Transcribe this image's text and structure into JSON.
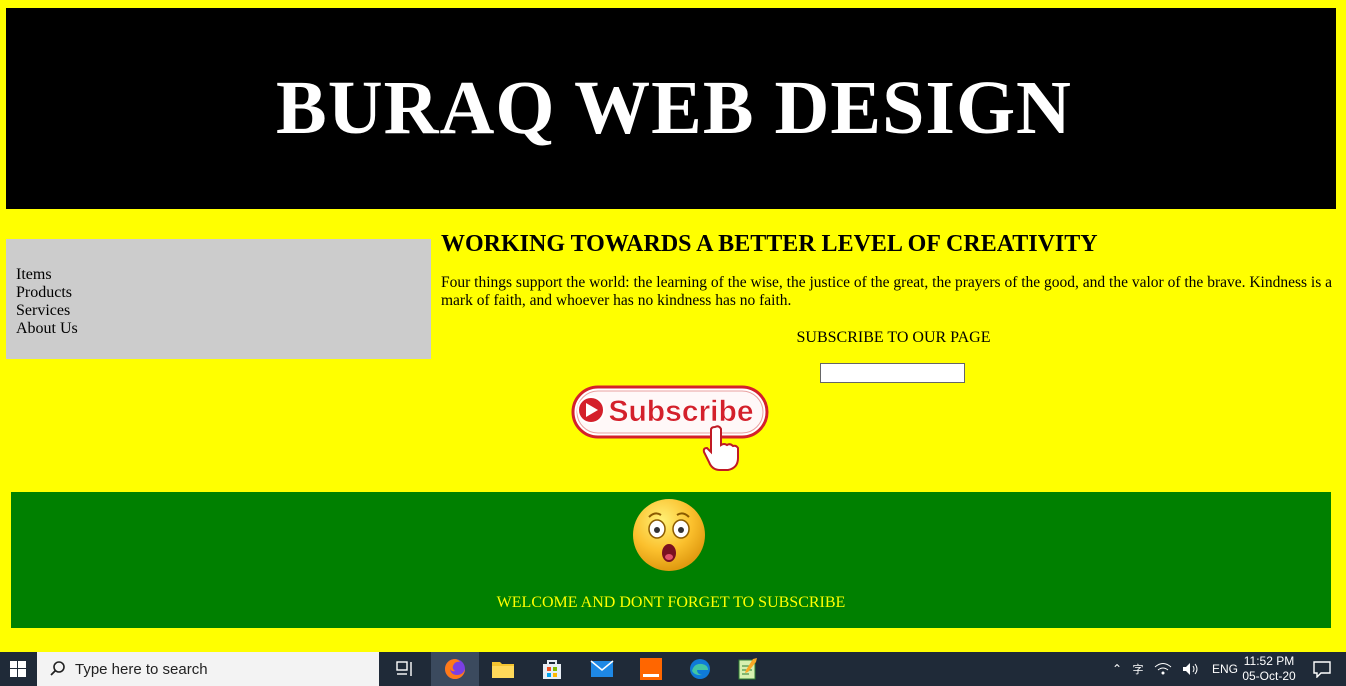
{
  "header": {
    "title": "BURAQ WEB DESIGN"
  },
  "sidebar": {
    "items": [
      {
        "label": "Items"
      },
      {
        "label": "Products"
      },
      {
        "label": "Services"
      },
      {
        "label": "About Us"
      }
    ]
  },
  "main": {
    "heading": "WORKING TOWARDS A BETTER LEVEL OF CREATIVITY",
    "paragraph": "Four things support the world: the learning of the wise, the justice of the great, the prayers of the good, and the valor of the brave. Kindness is a mark of faith, and whoever has no kindness has no faith.",
    "subscribe_title": "SUBSCRIBE TO OUR PAGE",
    "subscribe_input_value": "",
    "subscribe_button_label": "Subscribe"
  },
  "footer": {
    "emoji": "astonished-face",
    "text": "WELCOME AND DONT FORGET TO SUBSCRIBE"
  },
  "taskbar": {
    "search_placeholder": "Type here to search",
    "language": "ENG",
    "time": "11:52 PM",
    "date": "05-Oct-20",
    "pinned_icons": [
      "task-view-icon",
      "firefox-icon",
      "file-explorer-icon",
      "microsoft-store-icon",
      "mail-icon",
      "orange-app-icon",
      "edge-icon",
      "notepad-icon"
    ]
  },
  "colors": {
    "page_bg": "#ffff00",
    "header_bg": "#000000",
    "sidebar_bg": "#cccccc",
    "footer_bg": "#008000",
    "footer_text": "#ffff00",
    "subscribe_red": "#d4202b"
  }
}
